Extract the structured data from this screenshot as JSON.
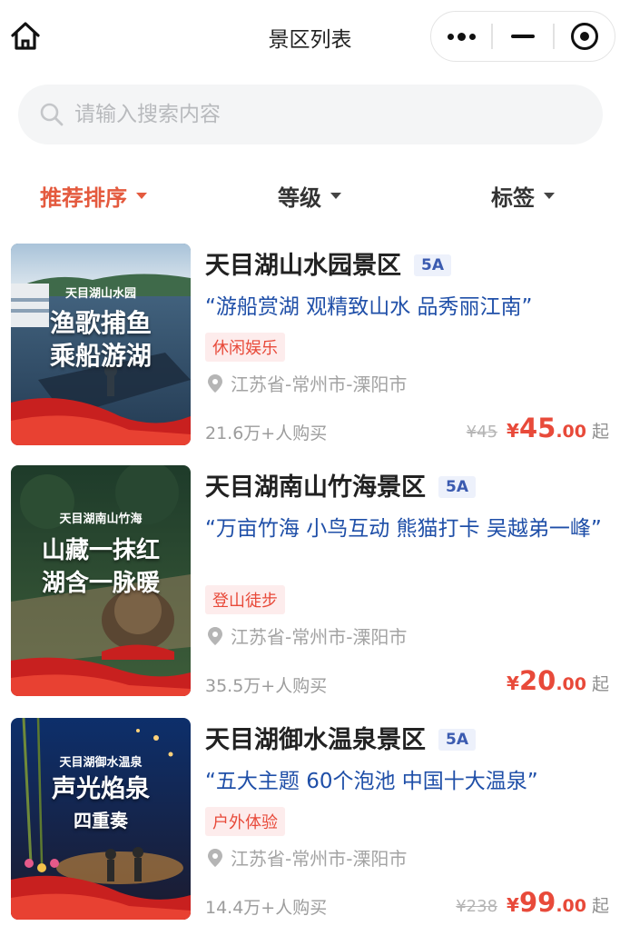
{
  "nav": {
    "title": "景区列表",
    "home_icon": "home-icon",
    "capsule": [
      "more-dots-icon",
      "minimize-icon",
      "close-target-icon"
    ]
  },
  "search": {
    "placeholder": "请输入搜索内容",
    "value": "",
    "icon": "search-icon"
  },
  "filters": [
    {
      "label": "推荐排序",
      "active": true
    },
    {
      "label": "等级",
      "active": false
    },
    {
      "label": "标签",
      "active": false
    }
  ],
  "colors": {
    "accent": "#e45a3e",
    "price": "#e84a3a",
    "slogan": "#1f4fa8",
    "grade_text": "#3b5bb0",
    "grade_bg": "#edf1fb",
    "tag_bg": "#fdecec"
  },
  "items": [
    {
      "name": "天目湖山水园景区",
      "grade": "5A",
      "slogan": "“游船赏湖 观精致山水 品秀丽江南”",
      "tag": "休闲娱乐",
      "location": "江苏省-常州市-溧阳市",
      "sold": "21.6万+人购买",
      "original_price": "¥45",
      "currency": "¥",
      "price_int": "45",
      "price_dec": ".00",
      "price_suffix": "起",
      "thumb_caption": "天目湖山水园",
      "thumb_headline1": "渔歌捕鱼",
      "thumb_headline2": "乘船游湖"
    },
    {
      "name": "天目湖南山竹海景区",
      "grade": "5A",
      "slogan": "“万亩竹海 小鸟互动 熊猫打卡 吴越弟一峰”",
      "tag": "登山徒步",
      "location": "江苏省-常州市-溧阳市",
      "sold": "35.5万+人购买",
      "original_price": "",
      "currency": "¥",
      "price_int": "20",
      "price_dec": ".00",
      "price_suffix": "起",
      "thumb_caption": "天目湖南山竹海",
      "thumb_headline1": "山藏一抹红",
      "thumb_headline2": "湖含一脉暖"
    },
    {
      "name": "天目湖御水温泉景区",
      "grade": "5A",
      "slogan": "“五大主题 60个泡池 中国十大温泉”",
      "tag": "户外体验",
      "location": "江苏省-常州市-溧阳市",
      "sold": "14.4万+人购买",
      "original_price": "¥238",
      "currency": "¥",
      "price_int": "99",
      "price_dec": ".00",
      "price_suffix": "起",
      "thumb_caption": "天目湖御水温泉",
      "thumb_headline1": "声光焰泉",
      "thumb_headline2": "四重奏"
    }
  ]
}
